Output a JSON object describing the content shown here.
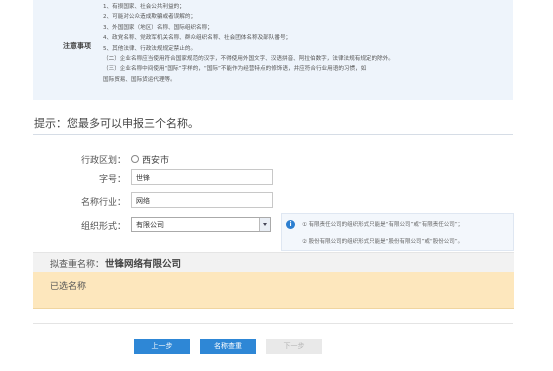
{
  "notice": {
    "label": "注意事项",
    "lines": [
      "1、有损国家、社会公共利益的；",
      "2、可能对公众造成欺骗或者误解的；",
      "3、外国国家（地区）名称、国际组织名称；",
      "4、政党名称、党政军机关名称、群众组织名称、社会团体名称及部队番号；",
      "5、其他法律、行政法规规定禁止的。",
      "（二）企业名称应当使用符合国家规范的汉字，不得使用外国文字、汉语拼音、阿拉伯数字，法律法规有规定的除外。",
      "（三）企业名称中间使用“国际”字样的，“国际”不能作为经营特点的修饰语，并应符合行业用语的习惯，如",
      "国际贸易、国际货运代理等。"
    ]
  },
  "hint": "提示：您最多可以申报三个名称。",
  "form": {
    "region_label": "行政区划：",
    "region_value": "西安市",
    "brand_label": "字号：",
    "brand_value": "世锋",
    "industry_label": "名称行业：",
    "industry_value": "网络",
    "org_label": "组织形式：",
    "org_value": "有限公司"
  },
  "tips": [
    "① 有限责任公司的组织形式只能是“有限公司”或“有限责任公司”；",
    "② 股份有限公司的组织形式只能是“股份有限公司”或“股份公司”。"
  ],
  "preview": {
    "label": "拟查重名称：",
    "value": "世锋网络有限公司"
  },
  "selected": {
    "label": "已选名称"
  },
  "buttons": {
    "prev": "上一步",
    "check": "名称查重",
    "next": "下一步"
  },
  "colors": {
    "accent": "#2e87d6",
    "selected_bg": "#fde7bd",
    "notice_bg": "#eef4fb"
  }
}
